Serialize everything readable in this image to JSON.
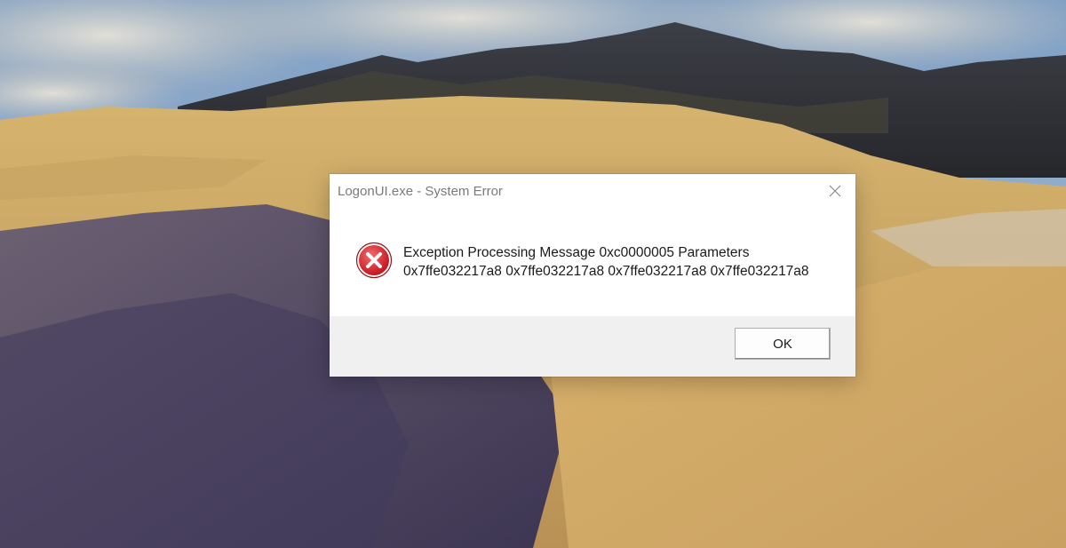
{
  "dialog": {
    "title": "LogonUI.exe - System Error",
    "message_line1": "Exception Processing Message 0xc0000005 Parameters",
    "message_line2": "0x7ffe032217a8 0x7ffe032217a8 0x7ffe032217a8 0x7ffe032217a8",
    "ok_label": "OK",
    "icon": "error-icon",
    "close_icon": "close-icon"
  },
  "colors": {
    "dialog_bg": "#ffffff",
    "footer_bg": "#f0f0f0",
    "error_red": "#d9232e",
    "title_text": "#7a7a7a"
  }
}
